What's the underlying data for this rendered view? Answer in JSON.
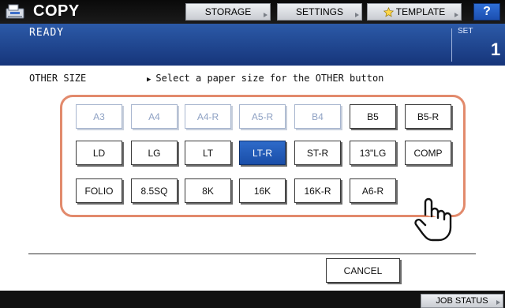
{
  "header": {
    "title": "COPY",
    "buttons": {
      "storage": "STORAGE",
      "settings": "SETTINGS",
      "template": "TEMPLATE",
      "help": "?"
    }
  },
  "status": {
    "text": "READY",
    "set_label": "SET",
    "set_value": "1"
  },
  "content": {
    "section_label": "OTHER SIZE",
    "instruction": "Select a paper size for the OTHER button"
  },
  "paper_sizes": {
    "row1": [
      {
        "label": "A3",
        "state": "disabled"
      },
      {
        "label": "A4",
        "state": "disabled"
      },
      {
        "label": "A4-R",
        "state": "disabled"
      },
      {
        "label": "A5-R",
        "state": "disabled"
      },
      {
        "label": "B4",
        "state": "disabled"
      },
      {
        "label": "B5",
        "state": "normal"
      },
      {
        "label": "B5-R",
        "state": "normal"
      }
    ],
    "row2": [
      {
        "label": "LD",
        "state": "normal"
      },
      {
        "label": "LG",
        "state": "normal"
      },
      {
        "label": "LT",
        "state": "normal"
      },
      {
        "label": "LT-R",
        "state": "selected"
      },
      {
        "label": "ST-R",
        "state": "normal"
      },
      {
        "label": "13\"LG",
        "state": "normal"
      },
      {
        "label": "COMP",
        "state": "normal"
      }
    ],
    "row3": [
      {
        "label": "FOLIO",
        "state": "normal"
      },
      {
        "label": "8.5SQ",
        "state": "normal"
      },
      {
        "label": "8K",
        "state": "normal"
      },
      {
        "label": "16K",
        "state": "normal"
      },
      {
        "label": "16K-R",
        "state": "normal"
      },
      {
        "label": "A6-R",
        "state": "normal"
      }
    ]
  },
  "footer": {
    "cancel": "CANCEL",
    "job_status": "JOB STATUS"
  },
  "colors": {
    "panel_border": "#e28a6c",
    "selected": "#1f55b0",
    "status_bar": "#1f428e"
  },
  "icons": {
    "copy": "copy-machine-icon",
    "template_star": "star-icon",
    "pointer": "hand-pointer-icon"
  }
}
